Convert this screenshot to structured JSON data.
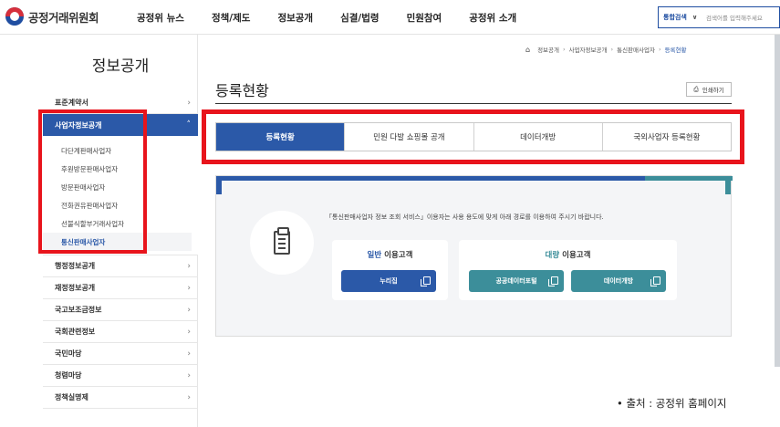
{
  "header": {
    "logo_text": "공정거래위원회",
    "nav": [
      "공정위 뉴스",
      "정책/제도",
      "정보공개",
      "심결/법령",
      "민원참여",
      "공정위 소개"
    ],
    "search": {
      "scope": "통합검색",
      "placeholder": "검색어를 입력해주세요"
    }
  },
  "sidebar": {
    "title": "정보공개",
    "items": [
      {
        "label": "표준계약서"
      },
      {
        "label": "사업자정보공개",
        "active": true,
        "sub": [
          {
            "label": "다단계판매사업자"
          },
          {
            "label": "후원방문판매사업자"
          },
          {
            "label": "방문판매사업자"
          },
          {
            "label": "전화권유판매사업자"
          },
          {
            "label": "선불식할부거래사업자"
          },
          {
            "label": "통신판매사업자",
            "selected": true
          }
        ]
      },
      {
        "label": "행정정보공개"
      },
      {
        "label": "재정정보공개"
      },
      {
        "label": "국고보조금정보"
      },
      {
        "label": "국회관련정보"
      },
      {
        "label": "국민마당"
      },
      {
        "label": "청렴마당"
      },
      {
        "label": "정책실명제"
      }
    ]
  },
  "breadcrumb": [
    "정보공개",
    "사업자정보공개",
    "통신판매사업자",
    "등록현황"
  ],
  "main": {
    "title": "등록현황",
    "print_label": "인쇄하기",
    "tabs": [
      {
        "label": "등록현황",
        "active": true
      },
      {
        "label": "민원 다발 쇼핑몰 공개"
      },
      {
        "label": "데이터개방"
      },
      {
        "label": "국외사업자 등록현황"
      }
    ],
    "notice": "「통신판매사업자 정보 조회 서비스」이용자는 사용 용도에 맞게 아래 경로를 이용하여 주시기 바랍니다.",
    "general": {
      "accent": "일반",
      "rest": " 이용고객",
      "buttons": [
        "누리집"
      ]
    },
    "bulk": {
      "accent": "대량",
      "rest": " 이용고객",
      "buttons": [
        "공공데이터포털",
        "데이터개방"
      ]
    }
  },
  "source": "• 출처 : 공정위 홈페이지",
  "colors": {
    "primary": "#2b59a8",
    "teal": "#3c8e9a",
    "highlight": "#e8141c"
  },
  "icons": [
    "fair-trade-logo-icon",
    "chevron-down-icon",
    "chevron-right-icon",
    "home-icon",
    "printer-icon",
    "clipboard-icon",
    "copy-link-icon"
  ]
}
